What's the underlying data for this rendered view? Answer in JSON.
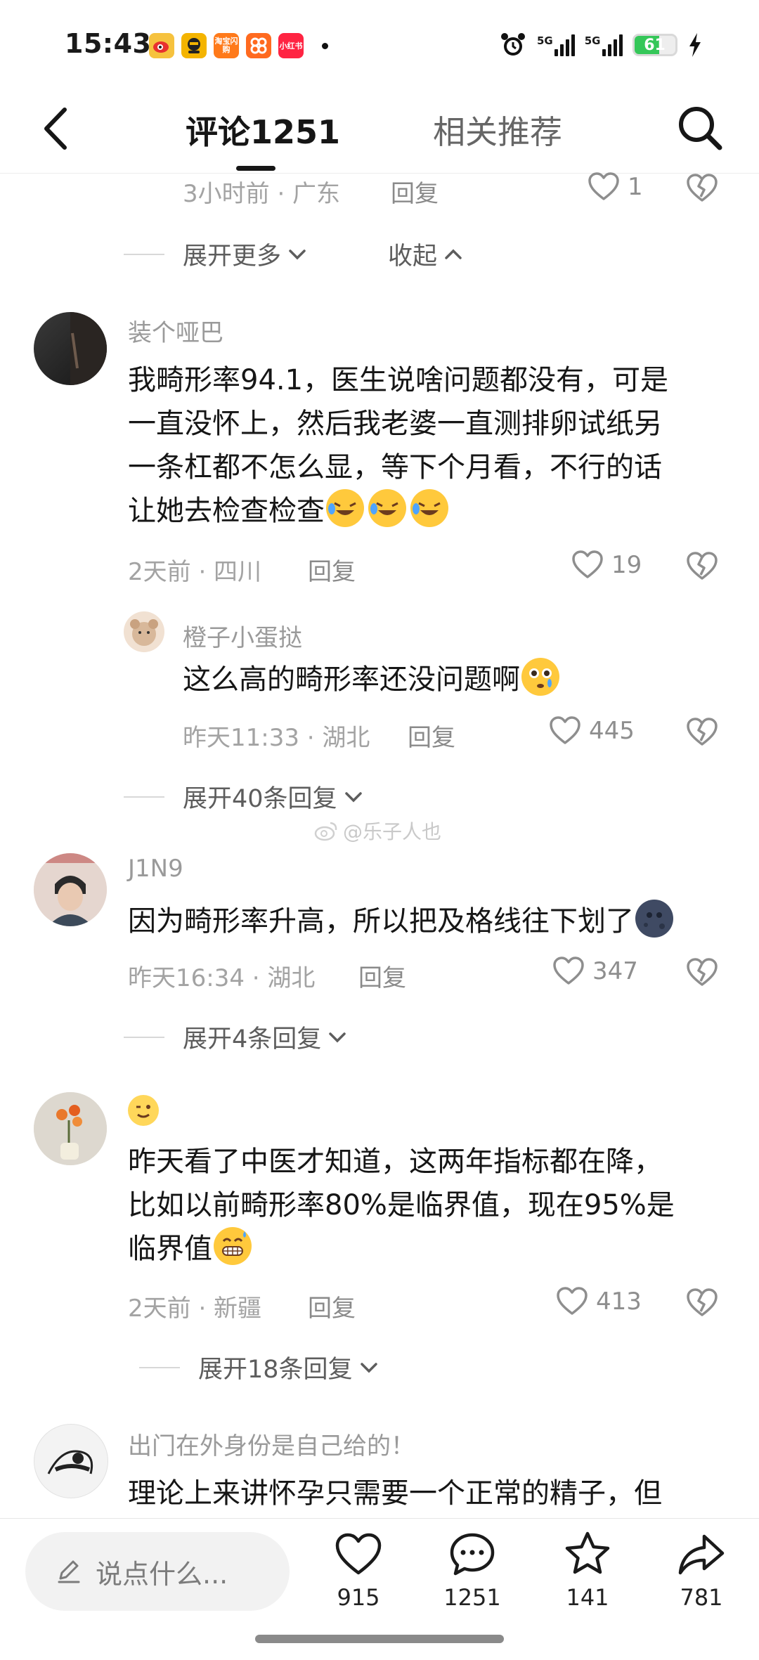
{
  "status_bar": {
    "time": "15:43",
    "app_icons": [
      {
        "name": "weibo-app-icon",
        "label": "",
        "color": "#f6c23e"
      },
      {
        "name": "app-icon-yellow",
        "label": "",
        "color": "#f4b400"
      },
      {
        "name": "taobao-shangou-app-icon",
        "label": "淘宝闪购",
        "color": "#ff7a1a"
      },
      {
        "name": "app-icon-orange",
        "label": "",
        "color": "#ff6a1f"
      },
      {
        "name": "xiaohongshu-app-icon",
        "label": "小红书",
        "color": "#ff2442"
      }
    ],
    "network_1": "5G",
    "network_2": "5G",
    "battery": "61",
    "battery_level": 0.61
  },
  "nav": {
    "tab_comments": "评论1251",
    "tab_related": "相关推荐"
  },
  "top_partial": {
    "meta": "3小时前 · 广东",
    "reply": "回复",
    "likes": "1",
    "expand_more": "展开更多",
    "collapse": "收起"
  },
  "comments": [
    {
      "username": "装个哑巴",
      "lines": [
        "我畸形率94.1，医生说啥问题都没有，可是",
        "一直没怀上，然后我老婆一直测排卵试纸另",
        "一条杠都不怎么显，等下个月看，不行的话",
        "让她去检查检查"
      ],
      "meta": "2天前 · 四川",
      "reply": "回复",
      "likes": "19",
      "sub_reply": {
        "username": "橙子小蛋挞",
        "text": "这么高的畸形率还没问题啊",
        "meta": "昨天11:33 · 湖北",
        "reply": "回复",
        "likes": "445"
      },
      "expand": "展开40条回复"
    },
    {
      "username": "J1N9",
      "text": "因为畸形率升高，所以把及格线往下划了",
      "meta": "昨天16:34 · 湖北",
      "reply": "回复",
      "likes": "347",
      "expand": "展开4条回复"
    },
    {
      "username": "",
      "lines": [
        "昨天看了中医才知道，这两年指标都在降，",
        "比如以前畸形率80%是临界值，现在95%是",
        "临界值"
      ],
      "meta": "2天前 · 新疆",
      "reply": "回复",
      "likes": "413",
      "expand": "展开18条回复"
    },
    {
      "username": "出门在外身份是自己给的！",
      "text": "理论上来讲怀孕只需要一个正常的精子，但"
    }
  ],
  "watermark": "@乐子人也",
  "bottom_bar": {
    "input_placeholder": "说点什么...",
    "like_count": "915",
    "comment_count": "1251",
    "favorite_count": "141",
    "share_count": "781"
  }
}
